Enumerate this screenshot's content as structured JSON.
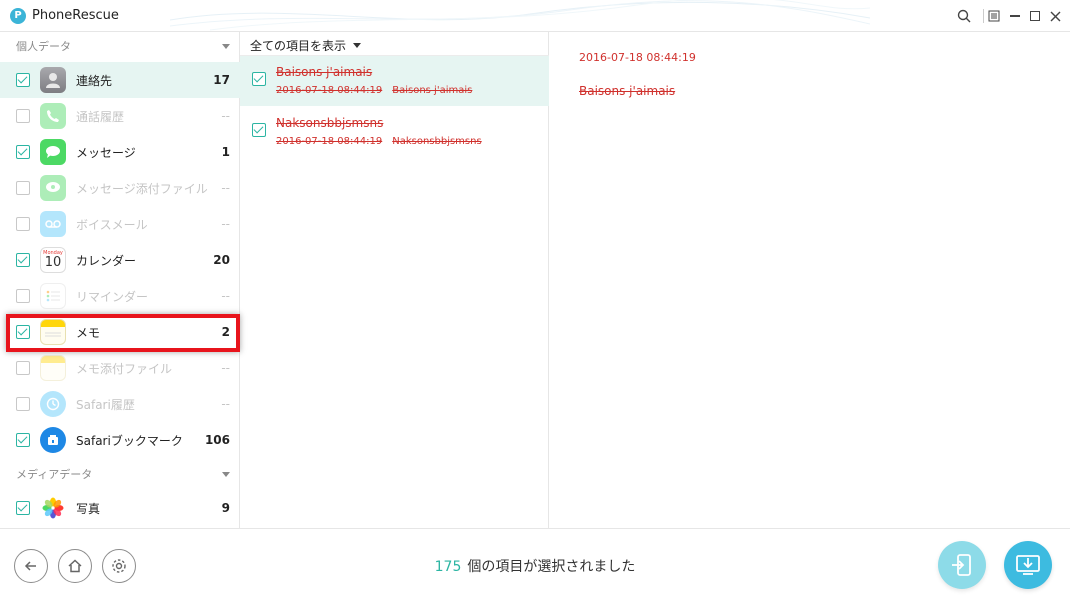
{
  "app": {
    "title": "PhoneRescue",
    "logo_letter": "P"
  },
  "sidebar": {
    "section_personal": "個人データ",
    "section_media": "メディアデータ",
    "items": [
      {
        "label": "連絡先",
        "count": "17",
        "checked": true,
        "dim": false,
        "icon": "contacts-icon",
        "color": "#8e8e93"
      },
      {
        "label": "通話履歴",
        "count": "--",
        "checked": false,
        "dim": true,
        "icon": "phone-icon",
        "color": "#4cd964"
      },
      {
        "label": "メッセージ",
        "count": "1",
        "checked": true,
        "dim": false,
        "icon": "messages-icon",
        "color": "#4cd964"
      },
      {
        "label": "メッセージ添付ファイル",
        "count": "--",
        "checked": false,
        "dim": true,
        "icon": "message-attachment-icon",
        "color": "#4cd964"
      },
      {
        "label": "ボイスメール",
        "count": "--",
        "checked": false,
        "dim": true,
        "icon": "voicemail-icon",
        "color": "#5ac8fa"
      },
      {
        "label": "カレンダー",
        "count": "20",
        "checked": true,
        "dim": false,
        "icon": "calendar-icon",
        "color": "#ffffff"
      },
      {
        "label": "リマインダー",
        "count": "--",
        "checked": false,
        "dim": true,
        "icon": "reminders-icon",
        "color": "#ffffff"
      },
      {
        "label": "メモ",
        "count": "2",
        "checked": true,
        "dim": false,
        "icon": "notes-icon",
        "color": "#ffd60a"
      },
      {
        "label": "メモ添付ファイル",
        "count": "--",
        "checked": false,
        "dim": true,
        "icon": "notes-attachment-icon",
        "color": "#ffd60a"
      },
      {
        "label": "Safari履歴",
        "count": "--",
        "checked": false,
        "dim": true,
        "icon": "safari-history-icon",
        "color": "#5ac8fa"
      },
      {
        "label": "Safariブックマーク",
        "count": "106",
        "checked": true,
        "dim": false,
        "icon": "safari-bookmark-icon",
        "color": "#1e88e5"
      }
    ],
    "media_items": [
      {
        "label": "写真",
        "count": "9",
        "checked": true,
        "dim": false,
        "icon": "photos-icon"
      }
    ]
  },
  "list": {
    "filter_label": "全ての項目を表示",
    "items": [
      {
        "title": "Baisons j'aimais",
        "date": "2016-07-18 08:44:19",
        "preview": "Baisons j'aimais",
        "checked": true,
        "active": true
      },
      {
        "title": "Naksonsbbjsmsns",
        "date": "2016-07-18 08:44:19",
        "preview": "Naksonsbbjsmsns",
        "checked": true,
        "active": false
      }
    ]
  },
  "detail": {
    "date": "2016-07-18 08:44:19",
    "body": "Baisons j'aimais"
  },
  "footer": {
    "selected_count": "175",
    "selected_text": "個の項目が選択されました"
  },
  "colors": {
    "accent": "#2cb5a3",
    "deleted": "#d0312d",
    "highlight": "#e8141c"
  }
}
